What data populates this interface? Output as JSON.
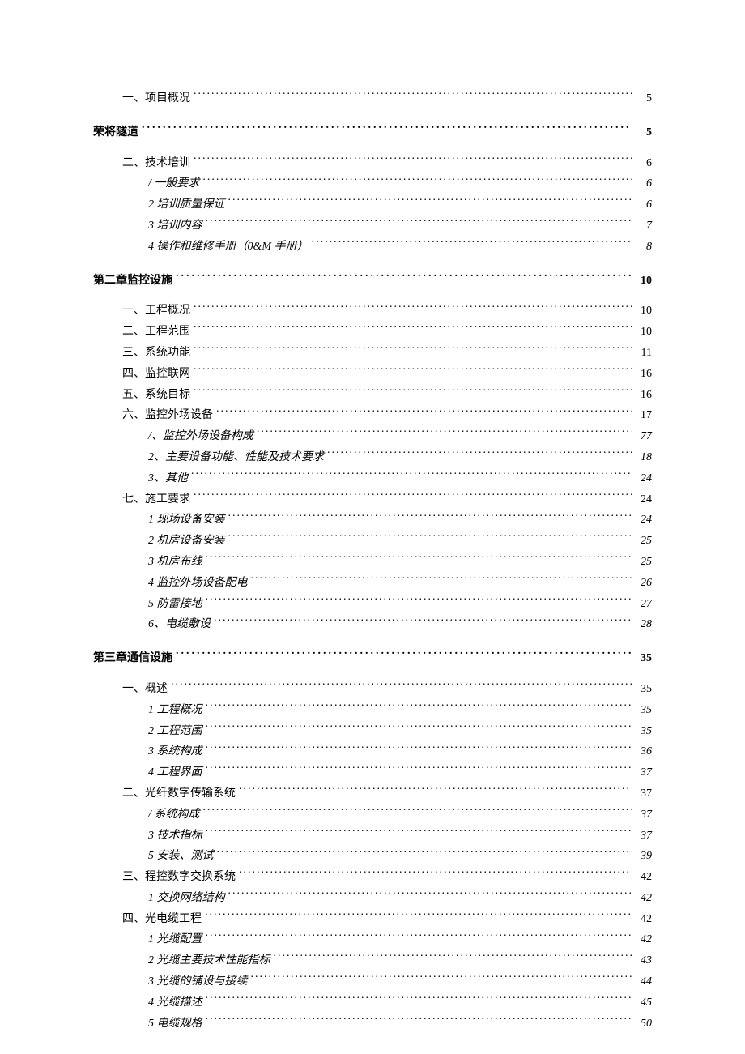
{
  "toc": [
    {
      "label": "一、项目概况",
      "page": "5",
      "level": 1,
      "style": "normal"
    },
    {
      "label": "荣将隧道",
      "page": "5",
      "level": 0,
      "style": "bold"
    },
    {
      "label": "二、技术培训",
      "page": "6",
      "level": 1,
      "style": "normal"
    },
    {
      "label": "/ 一般要求",
      "page": "6",
      "level": 2,
      "style": "italic"
    },
    {
      "label": "2 培训质量保证",
      "page": "6",
      "level": 2,
      "style": "italic"
    },
    {
      "label": "3 培训内容",
      "page": "7",
      "level": 2,
      "style": "italic"
    },
    {
      "label": "4 操作和维修手册（0&M 手册）",
      "page": "8",
      "level": 2,
      "style": "italic"
    },
    {
      "label": "第二章监控设施",
      "page": "10",
      "level": 0,
      "style": "bold"
    },
    {
      "label": "一、工程概况",
      "page": "10",
      "level": 1,
      "style": "normal"
    },
    {
      "label": "二、工程范围",
      "page": "10",
      "level": 1,
      "style": "normal"
    },
    {
      "label": "三、系统功能",
      "page": "11",
      "level": 1,
      "style": "normal"
    },
    {
      "label": "四、监控联网",
      "page": "16",
      "level": 1,
      "style": "normal"
    },
    {
      "label": "五、系统目标",
      "page": "16",
      "level": 1,
      "style": "normal"
    },
    {
      "label": "六、监控外场设备",
      "page": "17",
      "level": 1,
      "style": "normal"
    },
    {
      "label": "/、监控外场设备构成",
      "page": "77",
      "level": 2,
      "style": "italic"
    },
    {
      "label": "2、主要设备功能、性能及技术要求",
      "page": "18",
      "level": 2,
      "style": "italic"
    },
    {
      "label": "3、其他",
      "page": "24",
      "level": 2,
      "style": "italic"
    },
    {
      "label": "七、施工要求",
      "page": "24",
      "level": 1,
      "style": "normal"
    },
    {
      "label": "1 现场设备安装",
      "page": "24",
      "level": 2,
      "style": "italic"
    },
    {
      "label": "2 机房设备安装",
      "page": "25",
      "level": 2,
      "style": "italic"
    },
    {
      "label": "3 机房布线",
      "page": "25",
      "level": 2,
      "style": "italic"
    },
    {
      "label": "4 监控外场设备配电",
      "page": "26",
      "level": 2,
      "style": "italic"
    },
    {
      "label": "5 防雷接地",
      "page": "27",
      "level": 2,
      "style": "italic"
    },
    {
      "label": "6、电缆敷设",
      "page": "28",
      "level": 2,
      "style": "italic"
    },
    {
      "label": "第三章通信设施",
      "page": "35",
      "level": 0,
      "style": "bold"
    },
    {
      "label": "一、概述",
      "page": "35",
      "level": 1,
      "style": "normal"
    },
    {
      "label": "1 工程概况",
      "page": "35",
      "level": 2,
      "style": "italic"
    },
    {
      "label": "2 工程范围",
      "page": "35",
      "level": 2,
      "style": "italic"
    },
    {
      "label": "3 系统构成",
      "page": "36",
      "level": 2,
      "style": "italic"
    },
    {
      "label": "4 工程界面",
      "page": "37",
      "level": 2,
      "style": "italic"
    },
    {
      "label": "二、光纤数字传输系统",
      "page": "37",
      "level": 1,
      "style": "normal"
    },
    {
      "label": "/ 系统构成",
      "page": "37",
      "level": 2,
      "style": "italic"
    },
    {
      "label": "3 技术指标",
      "page": "37",
      "level": 2,
      "style": "italic"
    },
    {
      "label": "5 安装、测试",
      "page": "39",
      "level": 2,
      "style": "italic"
    },
    {
      "label": "三、程控数字交换系统",
      "page": "42",
      "level": 1,
      "style": "normal"
    },
    {
      "label": "1 交换网络结构",
      "page": "42",
      "level": 2,
      "style": "italic"
    },
    {
      "label": "四、光电缆工程",
      "page": "42",
      "level": 1,
      "style": "normal"
    },
    {
      "label": "1 光缆配置",
      "page": "42",
      "level": 2,
      "style": "italic"
    },
    {
      "label": "2 光缆主要技术性能指标",
      "page": "43",
      "level": 2,
      "style": "italic"
    },
    {
      "label": "3 光缆的铺设与接续",
      "page": "44",
      "level": 2,
      "style": "italic"
    },
    {
      "label": "4 光缆描述",
      "page": "45",
      "level": 2,
      "style": "italic"
    },
    {
      "label": "5 电缆规格",
      "page": "50",
      "level": 2,
      "style": "italic"
    }
  ]
}
